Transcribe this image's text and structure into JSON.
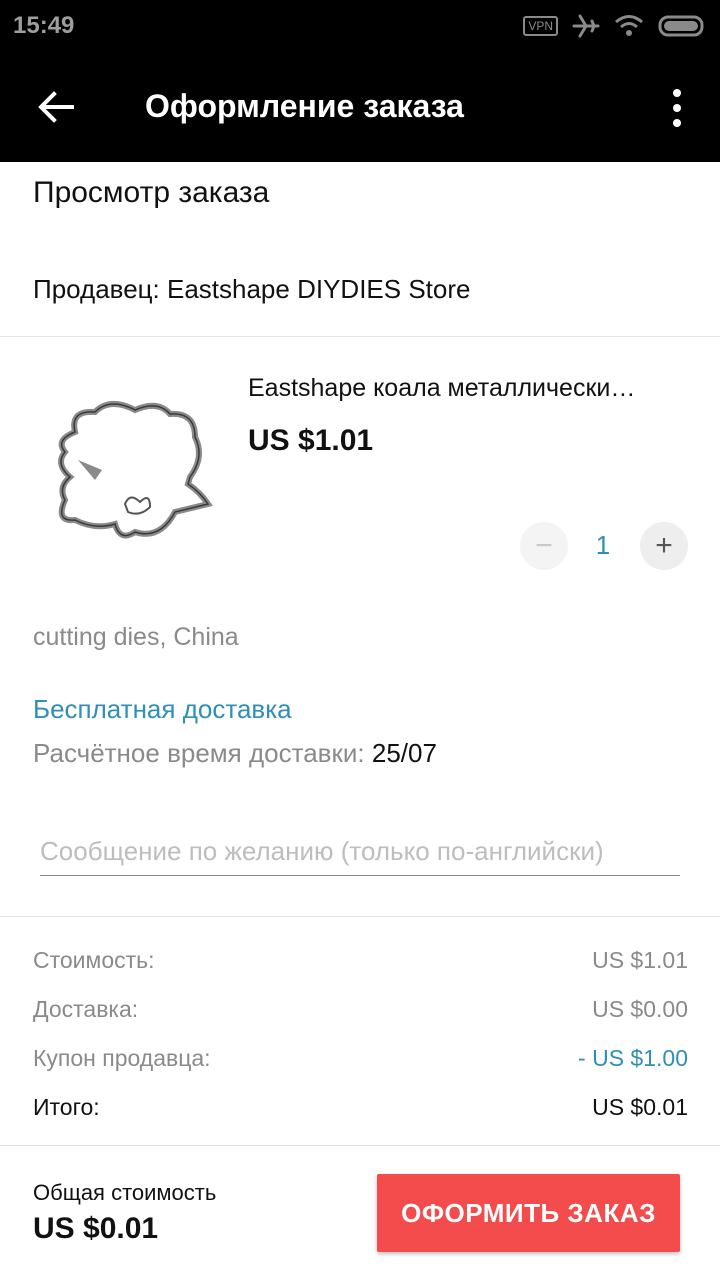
{
  "status_bar": {
    "time": "15:49",
    "vpn": "VPN",
    "icons": [
      "airplane-icon",
      "wifi-icon",
      "battery-icon"
    ]
  },
  "app_bar": {
    "title": "Оформление заказа",
    "back_icon": "arrow-left-icon",
    "menu_icon": "more-vert-icon"
  },
  "order": {
    "section_title": "Просмотр заказа",
    "seller": "Продавец: Eastshape DIYDIES Store",
    "product": {
      "name": "Eastshape коала металлически…",
      "price": "US $1.01",
      "quantity": "1",
      "attributes": "cutting dies, China"
    },
    "shipping": {
      "method": "Бесплатная доставка",
      "eta_label": "Расчётное время доставки:",
      "eta_date": "25/07"
    },
    "message": {
      "placeholder": "Сообщение по желанию (только по-английски)",
      "value": ""
    },
    "costs": [
      {
        "label": "Стоимость:",
        "value": "US $1.01"
      },
      {
        "label": "Доставка:",
        "value": "US $0.00"
      },
      {
        "label": "Купон продавца:",
        "value": "- US $1.00"
      },
      {
        "label": "Итого:",
        "value": "US $0.01"
      }
    ]
  },
  "footer": {
    "total_label": "Общая стоимость",
    "total_value": "US $0.01",
    "place_order": "ОФОРМИТЬ ЗАКАЗ"
  },
  "colors": {
    "accent_blue": "#2e8fb7",
    "button_red": "#f44c4c",
    "app_bar": "#000000"
  }
}
